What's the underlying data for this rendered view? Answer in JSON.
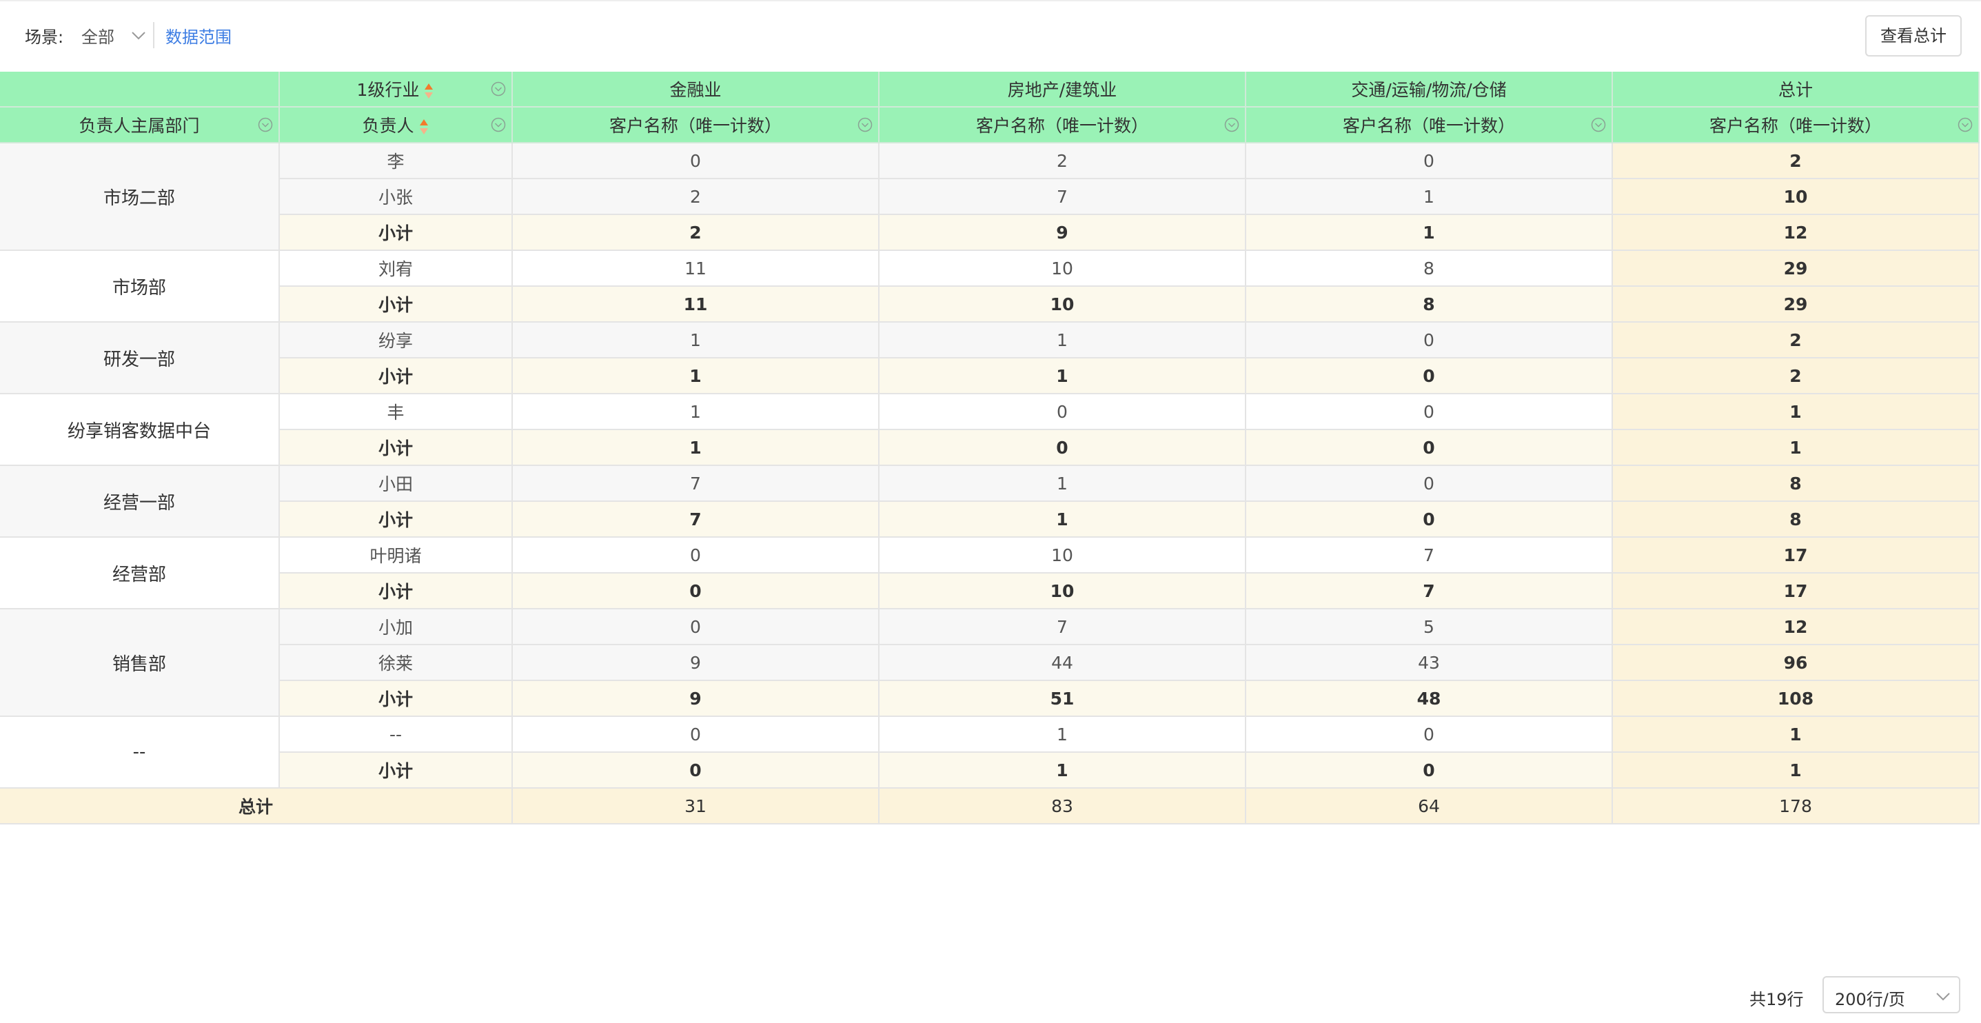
{
  "toolbar": {
    "scene_label": "场景:",
    "scene_value": "全部",
    "data_range_link": "数据范围",
    "view_total_button": "查看总计"
  },
  "table": {
    "header_row1": {
      "level1_industry": "1级行业",
      "columns": [
        "金融业",
        "房地产/建筑业",
        "交通/运输/物流/仓储",
        "总计"
      ]
    },
    "header_row2": {
      "dept": "负责人主属部门",
      "owner": "负责人",
      "measure": "客户名称（唯一计数）"
    },
    "subtotal_label": "小计",
    "grand_total_label": "总计",
    "groups": [
      {
        "dept": "市场二部",
        "rows": [
          {
            "name": "李",
            "v": [
              "0",
              "2",
              "0",
              "2"
            ]
          },
          {
            "name": "小张",
            "v": [
              "2",
              "7",
              "1",
              "10"
            ]
          }
        ],
        "subtotal": [
          "2",
          "9",
          "1",
          "12"
        ]
      },
      {
        "dept": "市场部",
        "rows": [
          {
            "name": "刘宥",
            "v": [
              "11",
              "10",
              "8",
              "29"
            ]
          }
        ],
        "subtotal": [
          "11",
          "10",
          "8",
          "29"
        ]
      },
      {
        "dept": "研发一部",
        "rows": [
          {
            "name": "纷享",
            "v": [
              "1",
              "1",
              "0",
              "2"
            ]
          }
        ],
        "subtotal": [
          "1",
          "1",
          "0",
          "2"
        ]
      },
      {
        "dept": "纷享销客数据中台",
        "rows": [
          {
            "name": "丰",
            "v": [
              "1",
              "0",
              "0",
              "1"
            ]
          }
        ],
        "subtotal": [
          "1",
          "0",
          "0",
          "1"
        ]
      },
      {
        "dept": "经营一部",
        "rows": [
          {
            "name": "小田",
            "v": [
              "7",
              "1",
              "0",
              "8"
            ]
          }
        ],
        "subtotal": [
          "7",
          "1",
          "0",
          "8"
        ]
      },
      {
        "dept": "经营部",
        "rows": [
          {
            "name": "叶明诸",
            "v": [
              "0",
              "10",
              "7",
              "17"
            ]
          }
        ],
        "subtotal": [
          "0",
          "10",
          "7",
          "17"
        ]
      },
      {
        "dept": "销售部",
        "rows": [
          {
            "name": "小加",
            "v": [
              "0",
              "7",
              "5",
              "12"
            ]
          },
          {
            "name": "徐莱",
            "v": [
              "9",
              "44",
              "43",
              "96"
            ]
          }
        ],
        "subtotal": [
          "9",
          "51",
          "48",
          "108"
        ]
      },
      {
        "dept": "--",
        "rows": [
          {
            "name": "--",
            "v": [
              "0",
              "1",
              "0",
              "1"
            ]
          }
        ],
        "subtotal": [
          "0",
          "1",
          "0",
          "1"
        ]
      }
    ],
    "grand_total": [
      "31",
      "83",
      "64",
      "178"
    ]
  },
  "footer": {
    "row_count": "共19行",
    "page_size": "200行/页"
  },
  "colors": {
    "header_bg": "#9af2b6",
    "subtotal_bg": "#fcf9ec",
    "total_bg": "#fcf3db",
    "link": "#3d7de3"
  }
}
